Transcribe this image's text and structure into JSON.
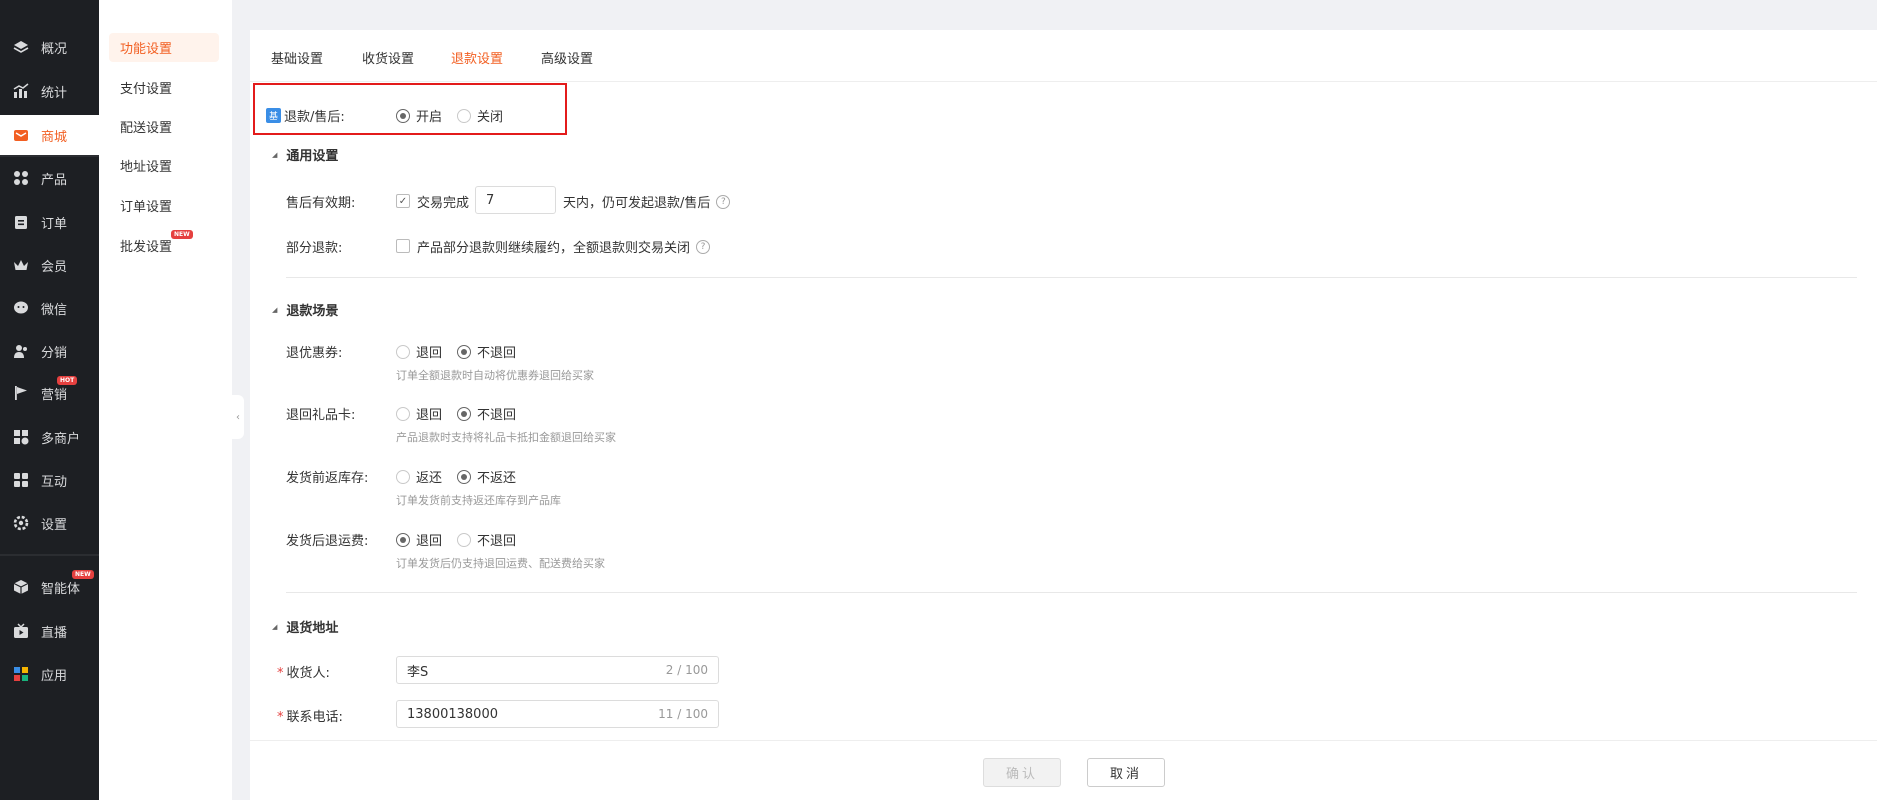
{
  "sidebar": {
    "items": [
      {
        "label": "概况",
        "icon": "layers-icon"
      },
      {
        "label": "统计",
        "icon": "chart-icon"
      },
      {
        "label": "商城",
        "icon": "mail-store-icon"
      },
      {
        "label": "产品",
        "icon": "grid-icon"
      },
      {
        "label": "订单",
        "icon": "clipboard-icon"
      },
      {
        "label": "会员",
        "icon": "crown-icon"
      },
      {
        "label": "微信",
        "icon": "wechat-icon"
      },
      {
        "label": "分销",
        "icon": "users-icon"
      },
      {
        "label": "营销",
        "icon": "flag-icon",
        "badge": "HOT"
      },
      {
        "label": "多商户",
        "icon": "shop-icon"
      },
      {
        "label": "互动",
        "icon": "interact-icon"
      },
      {
        "label": "设置",
        "icon": "gear-icon"
      },
      {
        "label": "智能体",
        "icon": "cube-icon",
        "badge": "NEW"
      },
      {
        "label": "直播",
        "icon": "tv-icon"
      },
      {
        "label": "应用",
        "icon": "apps-icon"
      }
    ]
  },
  "submenu": {
    "items": [
      {
        "label": "功能设置"
      },
      {
        "label": "支付设置"
      },
      {
        "label": "配送设置"
      },
      {
        "label": "地址设置"
      },
      {
        "label": "订单设置"
      },
      {
        "label": "批发设置",
        "badge": "NEW"
      }
    ]
  },
  "tabs": [
    "基础设置",
    "收货设置",
    "退款设置",
    "高级设置"
  ],
  "refund_toggle": {
    "icon_text": "基",
    "label": "退款/售后:",
    "on": "开启",
    "off": "关闭"
  },
  "general": {
    "title": "通用设置",
    "validity_label": "售后有效期:",
    "validity_check": "交易完成",
    "validity_days": "7",
    "validity_suffix": "天内，仍可发起退款/售后",
    "partial_label": "部分退款:",
    "partial_text": "产品部分退款则继续履约，全额退款则交易关闭"
  },
  "scenes": {
    "title": "退款场景",
    "coupon": {
      "label": "退优惠券:",
      "opt1": "退回",
      "opt2": "不退回",
      "hint": "订单全额退款时自动将优惠券退回给买家"
    },
    "giftcard": {
      "label": "退回礼品卡:",
      "opt1": "退回",
      "opt2": "不退回",
      "hint": "产品退款时支持将礼品卡抵扣金额退回给买家"
    },
    "stock": {
      "label": "发货前返库存:",
      "opt1": "返还",
      "opt2": "不返还",
      "hint": "订单发货前支持返还库存到产品库"
    },
    "freight": {
      "label": "发货后退运费:",
      "opt1": "退回",
      "opt2": "不退回",
      "hint": "订单发货后仍支持退回运费、配送费给买家"
    }
  },
  "address": {
    "title": "退货地址",
    "receiver_label": "收货人:",
    "receiver_value": "李S",
    "receiver_count": "2 / 100",
    "phone_label": "联系电话:",
    "phone_value": "13800138000",
    "phone_count": "11 / 100",
    "required_mark": "*"
  },
  "footer": {
    "confirm": "确认",
    "cancel": "取消"
  },
  "colors": {
    "accent": "#f25f22",
    "sidebar_bg": "#1d1f23",
    "highlight": "#e31b1b"
  }
}
